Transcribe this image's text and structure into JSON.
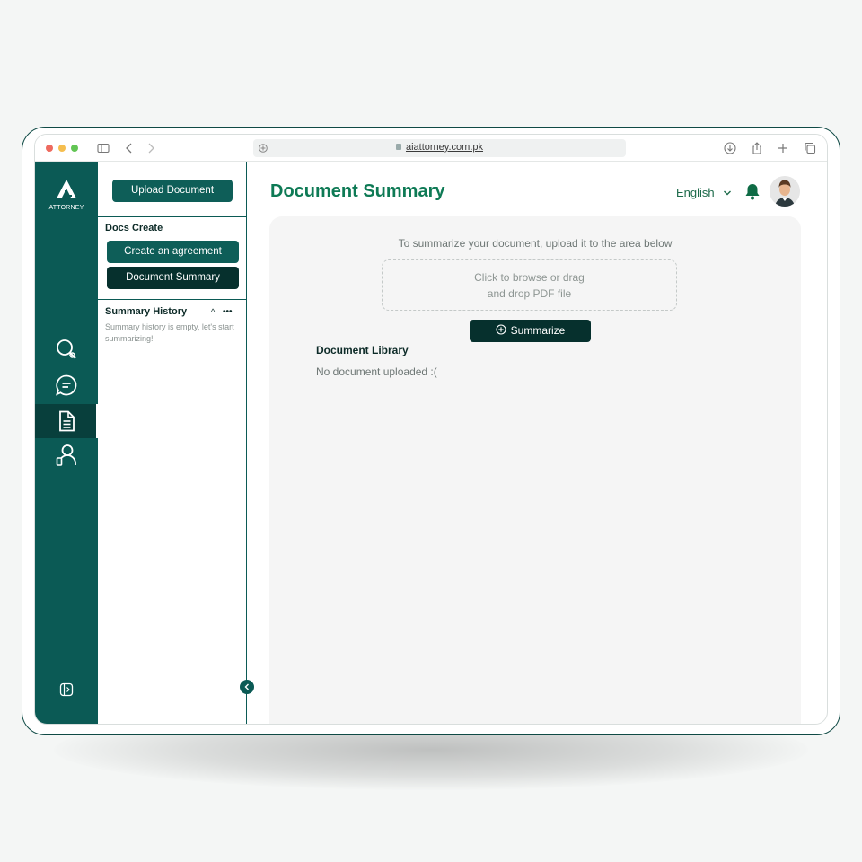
{
  "browser": {
    "url": "aiattorney.com.pk"
  },
  "rail": {
    "logo_text": "ATTORNEY",
    "icons": [
      "search-icon",
      "chat-icon",
      "document-icon",
      "user-icon",
      "sidebar-toggle-icon"
    ]
  },
  "panel": {
    "upload_label": "Upload Document",
    "docs_create_title": "Docs Create",
    "create_agreement_label": "Create an agreement",
    "document_summary_label": "Document Summary",
    "history_title": "Summary History",
    "history_empty": "Summary history is empty, let's start summarizing!",
    "history_caret": "^",
    "history_more": "•••"
  },
  "header": {
    "title": "Document Summary",
    "language": "English"
  },
  "main": {
    "upload_hint": "To summarize your document, upload it to the area below",
    "dropzone_line1": "Click to browse or drag",
    "dropzone_line2": "and drop PDF file",
    "summarize_label": "Summarize",
    "library_title": "Document Library",
    "library_empty": "No document uploaded :("
  },
  "colors": {
    "rail": "#0b5a55",
    "button": "#0e5e58",
    "button_dark": "#06302d",
    "title": "#0e7a55"
  }
}
